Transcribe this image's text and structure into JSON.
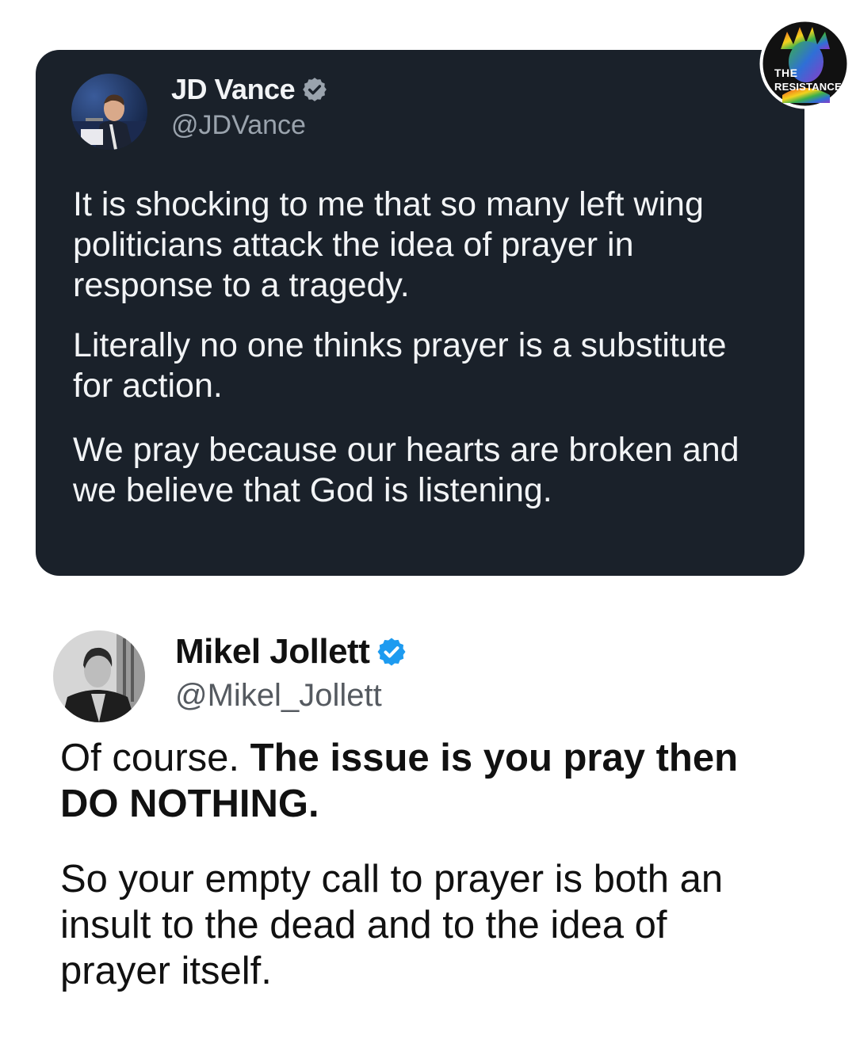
{
  "original_tweet": {
    "author_name": "JD Vance",
    "handle": "@JDVance",
    "verified_badge_color": "#1d9bf0",
    "paragraphs": [
      "It is shocking to me that so many left wing politicians attack the idea of prayer in response to a tragedy.",
      "Literally no one thinks prayer is a substitute for action.",
      "We pray because our hearts are broken and we believe that God is listening."
    ]
  },
  "reply_tweet": {
    "author_name": "Mikel Jollett",
    "handle": "@Mikel_Jollett",
    "verified_badge_color": "#1d9bf0",
    "paragraph1_plain": "Of course. ",
    "paragraph1_bold": "The issue is you pray then DO NOTHING.",
    "paragraph2": "So your empty call to prayer is both an insult to the dead and to the idea of prayer itself."
  },
  "watermark": {
    "line1": "THE",
    "line2": "RESISTANCE",
    "icon": "statue-of-liberty-icon"
  },
  "colors": {
    "card_background": "#1a212a",
    "page_background": "#ffffff"
  }
}
